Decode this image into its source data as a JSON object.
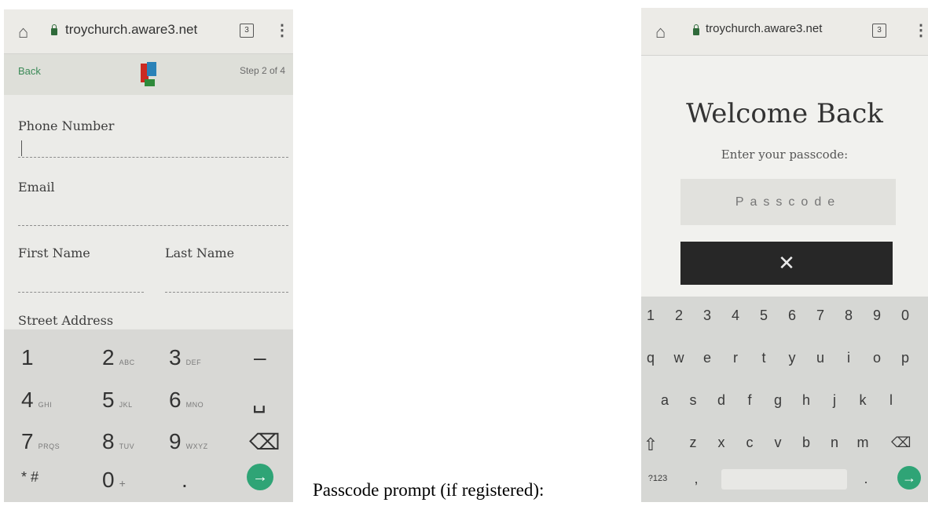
{
  "phone1": {
    "url": "troychurch.aware3.net",
    "tab_count": "3",
    "back": "Back",
    "step": "Step 2 of 4",
    "fields": {
      "phone": "Phone Number",
      "email": "Email",
      "first": "First Name",
      "last": "Last Name",
      "street": "Street Address"
    },
    "numpad": [
      {
        "main": "1",
        "sub": ""
      },
      {
        "main": "2",
        "sub": "ABC"
      },
      {
        "main": "3",
        "sub": "DEF"
      },
      {
        "main": "–",
        "sub": ""
      },
      {
        "main": "4",
        "sub": "GHI"
      },
      {
        "main": "5",
        "sub": "JKL"
      },
      {
        "main": "6",
        "sub": "MNO"
      },
      {
        "main": "␣",
        "sub": ""
      },
      {
        "main": "7",
        "sub": "PRQS"
      },
      {
        "main": "8",
        "sub": "TUV"
      },
      {
        "main": "9",
        "sub": "WXYZ"
      },
      {
        "main": "⌫",
        "sub": ""
      },
      {
        "main": "* #",
        "sub": ""
      },
      {
        "main": "0",
        "sub": "+"
      },
      {
        "main": ".",
        "sub": ""
      },
      {
        "main": "→",
        "sub": ""
      }
    ]
  },
  "caption": "Passcode prompt (if registered):",
  "phone2": {
    "url": "troychurch.aware3.net",
    "tab_count": "3",
    "title": "Welcome Back",
    "subtitle": "Enter your passcode:",
    "passcode_placeholder": "Passcode",
    "clear_button": "✕",
    "keyboard": {
      "row1": [
        "1",
        "2",
        "3",
        "4",
        "5",
        "6",
        "7",
        "8",
        "9",
        "0"
      ],
      "row2": [
        "q",
        "w",
        "e",
        "r",
        "t",
        "y",
        "u",
        "i",
        "o",
        "p"
      ],
      "row3": [
        "a",
        "s",
        "d",
        "f",
        "g",
        "h",
        "j",
        "k",
        "l"
      ],
      "row4": [
        "⇧",
        "z",
        "x",
        "c",
        "v",
        "b",
        "n",
        "m",
        "⌫"
      ],
      "symbols_key": "?123",
      "comma": ",",
      "period": ".",
      "enter": "→"
    }
  },
  "icons": {
    "home": "home-icon",
    "lock": "lock-icon",
    "tabs": "tab-switcher-icon",
    "menu": "overflow-menu-icon"
  },
  "colors": {
    "accent_green": "#2fa476",
    "link_green": "#3c8a58",
    "dark_button": "#272727"
  }
}
